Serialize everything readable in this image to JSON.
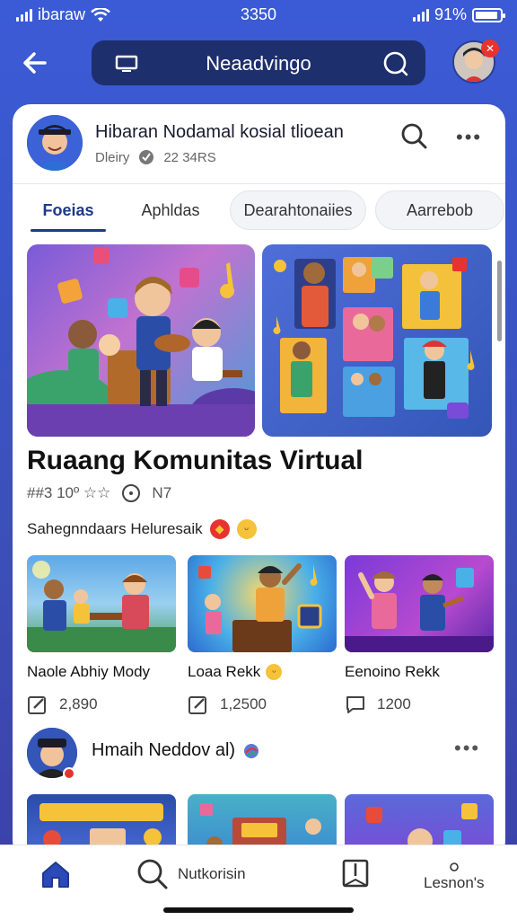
{
  "status_bar": {
    "carrier": "ibaraw",
    "time": "3350",
    "battery_text": "91%",
    "battery_level": 0.91
  },
  "nav": {
    "title": "Neaadvingo",
    "badge": "✕"
  },
  "profile": {
    "title": "Hibaran Nodamal kosial tlioean",
    "meta_name": "Dleiry",
    "meta_count": "22 34RS"
  },
  "tabs": [
    {
      "label": "Foeias"
    },
    {
      "label": "Aphldas"
    },
    {
      "label": "Dearahtonaiies"
    },
    {
      "label": "Aarrebob"
    }
  ],
  "section": {
    "title": "Ruaang Komunitas Virtual",
    "meta_left": "#‪#3 10º ☆☆",
    "meta_right": "N7",
    "subtitle": "Sahegnndaars Heluresaik"
  },
  "grid": [
    {
      "label": "Naole Abhiy Mody",
      "count": "2,890"
    },
    {
      "label": "Loaa Rekk",
      "count": "1,2500"
    },
    {
      "label": "Eenoino Rekk",
      "count": "1200"
    }
  ],
  "post": {
    "name": "Hmaih Neddov al)"
  },
  "bottom_nav": {
    "search_label": "Nutkorisin",
    "lessons_label": "Lesnon's"
  },
  "colors": {
    "accent": "#1e3a8a",
    "background": "#3b5bd6",
    "badge": "#e7332f"
  }
}
